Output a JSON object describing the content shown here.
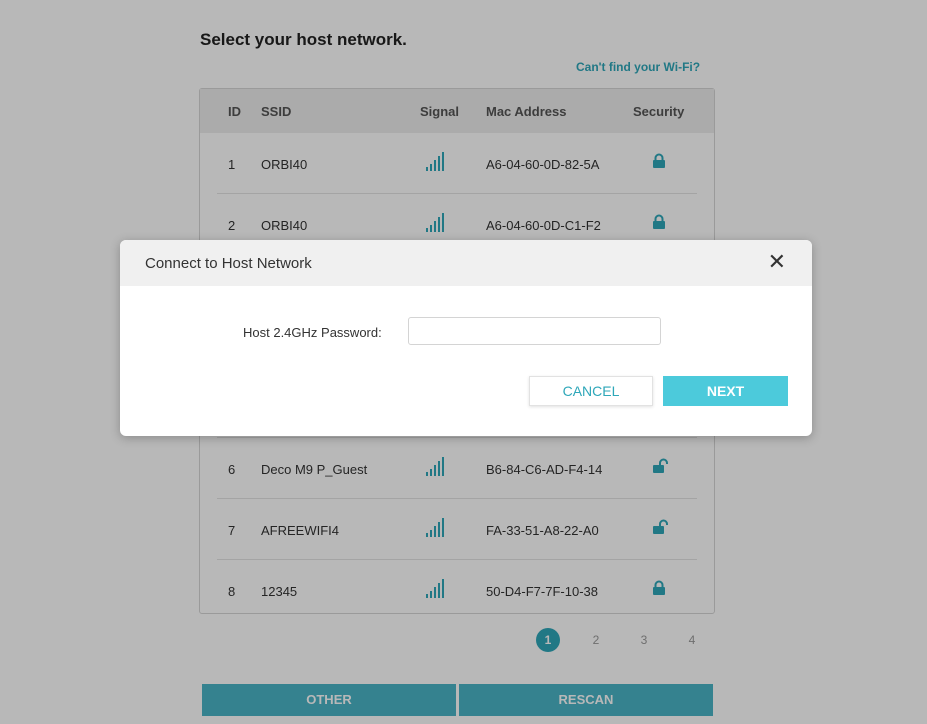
{
  "page": {
    "title": "Select your host network.",
    "help_link": "Can't find your Wi-Fi?"
  },
  "table": {
    "headers": {
      "id": "ID",
      "ssid": "SSID",
      "signal": "Signal",
      "mac": "Mac Address",
      "security": "Security"
    },
    "rows": [
      {
        "id": "1",
        "ssid": "ORBI40",
        "mac": "A6-04-60-0D-82-5A",
        "security": "locked",
        "signal_bars": 5
      },
      {
        "id": "2",
        "ssid": "ORBI40",
        "mac": "A6-04-60-0D-C1-F2",
        "security": "locked",
        "signal_bars": 5
      },
      {
        "id": "6",
        "ssid": "Deco M9 P_Guest",
        "mac": "B6-84-C6-AD-F4-14",
        "security": "unlocked",
        "signal_bars": 5
      },
      {
        "id": "7",
        "ssid": "AFREEWIFI4",
        "mac": "FA-33-51-A8-22-A0",
        "security": "unlocked",
        "signal_bars": 5
      },
      {
        "id": "8",
        "ssid": "12345",
        "mac": "50-D4-F7-7F-10-38",
        "security": "locked",
        "signal_bars": 5
      }
    ]
  },
  "pagination": {
    "pages": [
      "1",
      "2",
      "3",
      "4"
    ],
    "current": "1"
  },
  "buttons": {
    "other": "OTHER",
    "rescan": "RESCAN"
  },
  "modal": {
    "title": "Connect to Host Network",
    "close_icon": "close-icon",
    "password_label": "Host 2.4GHz Password:",
    "password_value": "",
    "password_placeholder": "",
    "cancel": "CANCEL",
    "next": "NEXT"
  },
  "colors": {
    "accent": "#2ea7b9",
    "button_primary": "#4ccadb",
    "button_secondary": "#4ab4c6"
  }
}
